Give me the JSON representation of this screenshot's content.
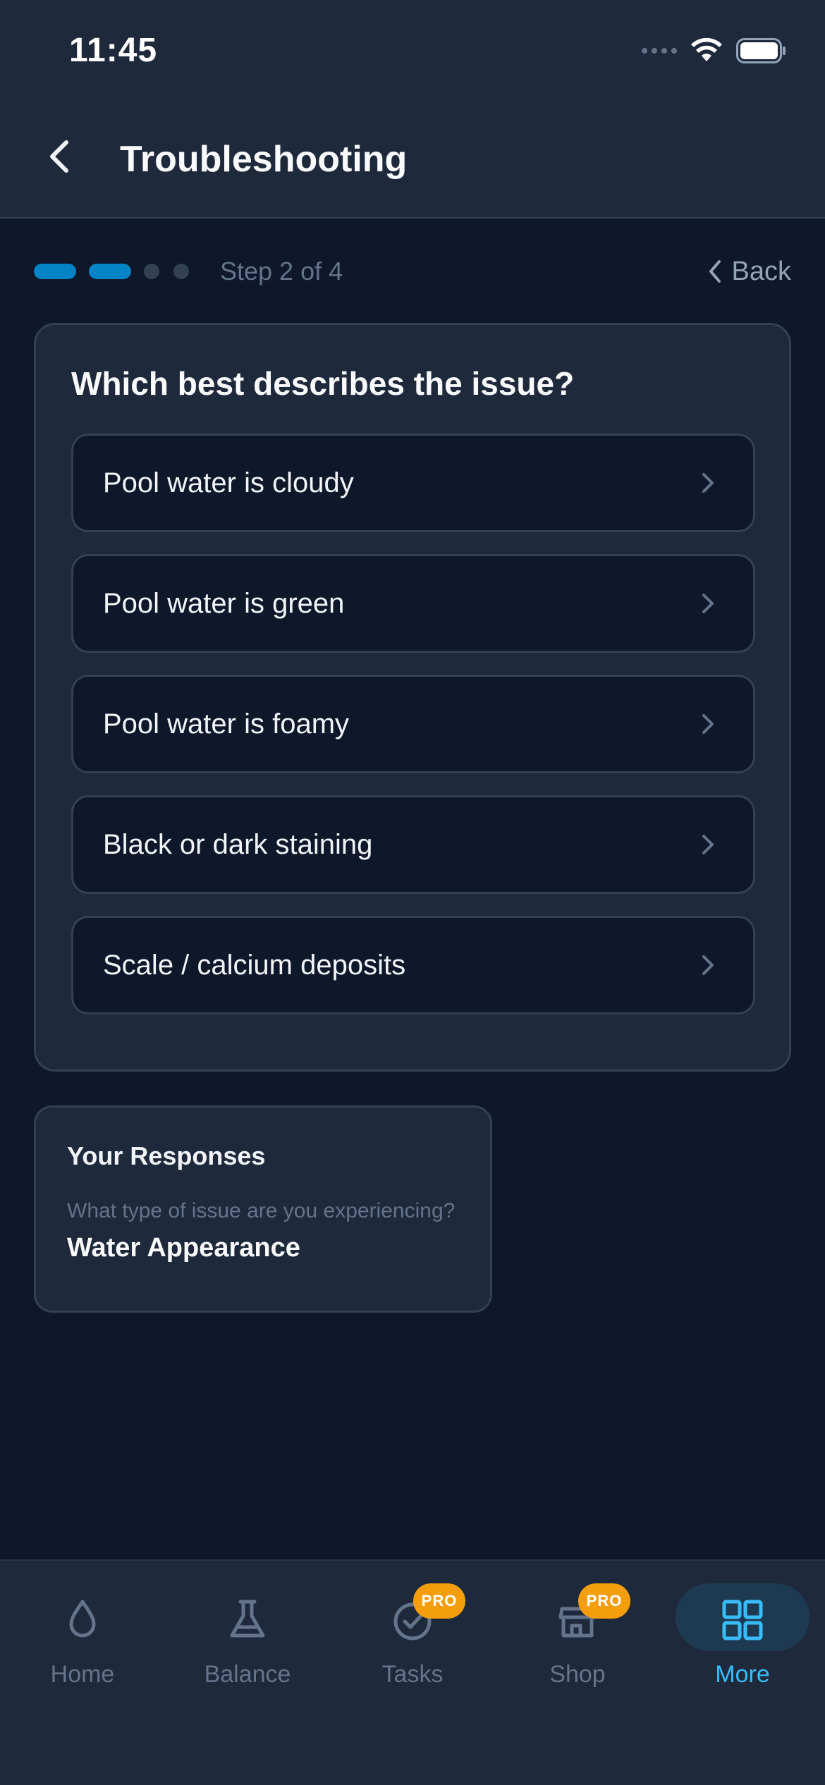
{
  "status_bar": {
    "time": "11:45"
  },
  "header": {
    "title": "Troubleshooting"
  },
  "progress": {
    "step_text": "Step 2 of 4",
    "current_step": 2,
    "total_steps": 4,
    "back_label": "Back"
  },
  "question": {
    "title": "Which best describes the issue?",
    "options": [
      {
        "label": "Pool water is cloudy"
      },
      {
        "label": "Pool water is green"
      },
      {
        "label": "Pool water is foamy"
      },
      {
        "label": "Black or dark staining"
      },
      {
        "label": "Scale / calcium deposits"
      }
    ]
  },
  "responses": {
    "title": "Your Responses",
    "items": [
      {
        "question": "What type of issue are you experiencing?",
        "answer": "Water Appearance"
      }
    ]
  },
  "bottom_nav": {
    "items": [
      {
        "label": "Home",
        "icon": "drop-icon",
        "badge": ""
      },
      {
        "label": "Balance",
        "icon": "flask-icon",
        "badge": ""
      },
      {
        "label": "Tasks",
        "icon": "check-circle-icon",
        "badge": "PRO"
      },
      {
        "label": "Shop",
        "icon": "store-icon",
        "badge": "PRO"
      },
      {
        "label": "More",
        "icon": "grid-icon",
        "badge": ""
      }
    ],
    "active": "More"
  },
  "colors": {
    "background": "#0f172a",
    "surface": "#1e293b",
    "accent": "#0284c7",
    "active_nav": "#38bdf8",
    "badge": "#f59e0b"
  }
}
